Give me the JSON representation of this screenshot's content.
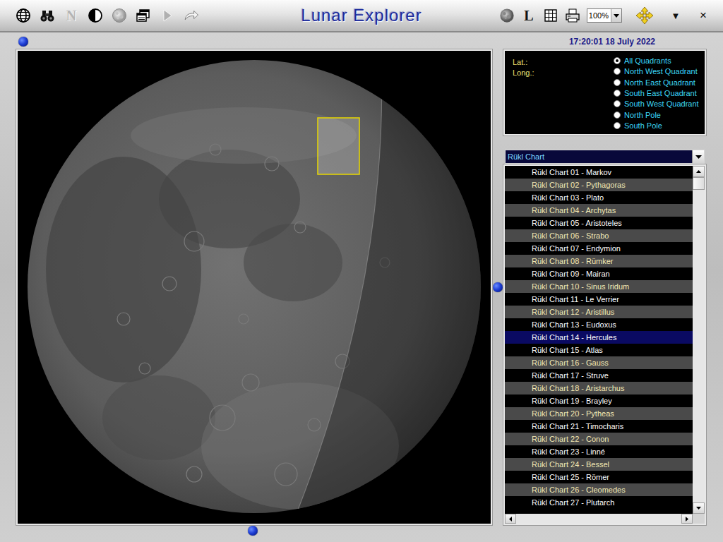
{
  "window": {
    "title": "Lunar Explorer"
  },
  "toolbar": {
    "n_button": {
      "label": "N",
      "disabled": true
    },
    "play_button": {
      "disabled": true
    },
    "l_button": {
      "label": "L"
    },
    "zoom": "100%",
    "menu": "▼",
    "close": "×"
  },
  "timestamp": "17:20:01 18 July 2022",
  "coords": {
    "lat_label": "Lat.:",
    "long_label": "Long.:"
  },
  "quadrants": [
    {
      "label": "All Quadrants",
      "selected": true
    },
    {
      "label": "North West Quadrant",
      "selected": false
    },
    {
      "label": "North East Quadrant",
      "selected": false
    },
    {
      "label": "South East Quadrant",
      "selected": false
    },
    {
      "label": "South West Quadrant",
      "selected": false
    },
    {
      "label": "North Pole",
      "selected": false
    },
    {
      "label": "South Pole",
      "selected": false
    }
  ],
  "chart_type": {
    "value": "Rükl Chart"
  },
  "charts": [
    {
      "label": "Rükl Chart 01 - Markov",
      "selected": false
    },
    {
      "label": "Rükl Chart 02 - Pythagoras",
      "selected": false
    },
    {
      "label": "Rükl Chart 03 - Plato",
      "selected": false
    },
    {
      "label": "Rükl Chart 04 - Archytas",
      "selected": false
    },
    {
      "label": "Rükl Chart 05 - Aristoteles",
      "selected": false
    },
    {
      "label": "Rükl Chart 06 - Strabo",
      "selected": false
    },
    {
      "label": "Rükl Chart 07 - Endymion",
      "selected": false
    },
    {
      "label": "Rükl Chart 08 - Rümker",
      "selected": false
    },
    {
      "label": "Rükl Chart 09 - Mairan",
      "selected": false
    },
    {
      "label": "Rükl Chart 10 - Sinus Iridum",
      "selected": false
    },
    {
      "label": "Rükl Chart 11 - Le Verrier",
      "selected": false
    },
    {
      "label": "Rükl Chart 12 - Aristillus",
      "selected": false
    },
    {
      "label": "Rükl Chart 13 - Eudoxus",
      "selected": false
    },
    {
      "label": "Rükl Chart 14 - Hercules",
      "selected": true
    },
    {
      "label": "Rükl Chart 15 - Atlas",
      "selected": false
    },
    {
      "label": "Rükl Chart 16 - Gauss",
      "selected": false
    },
    {
      "label": "Rükl Chart 17 - Struve",
      "selected": false
    },
    {
      "label": "Rükl Chart 18 - Aristarchus",
      "selected": false
    },
    {
      "label": "Rükl Chart 19 - Brayley",
      "selected": false
    },
    {
      "label": "Rükl Chart 20 - Pytheas",
      "selected": false
    },
    {
      "label": "Rükl Chart 21 - Timocharis",
      "selected": false
    },
    {
      "label": "Rükl Chart 22 - Conon",
      "selected": false
    },
    {
      "label": "Rükl Chart 23 - Linné",
      "selected": false
    },
    {
      "label": "Rükl Chart 24 - Bessel",
      "selected": false
    },
    {
      "label": "Rükl Chart 25 - Römer",
      "selected": false
    },
    {
      "label": "Rükl Chart 26 - Cleomedes",
      "selected": false
    },
    {
      "label": "Rükl Chart 27 - Plutarch",
      "selected": false
    }
  ]
}
